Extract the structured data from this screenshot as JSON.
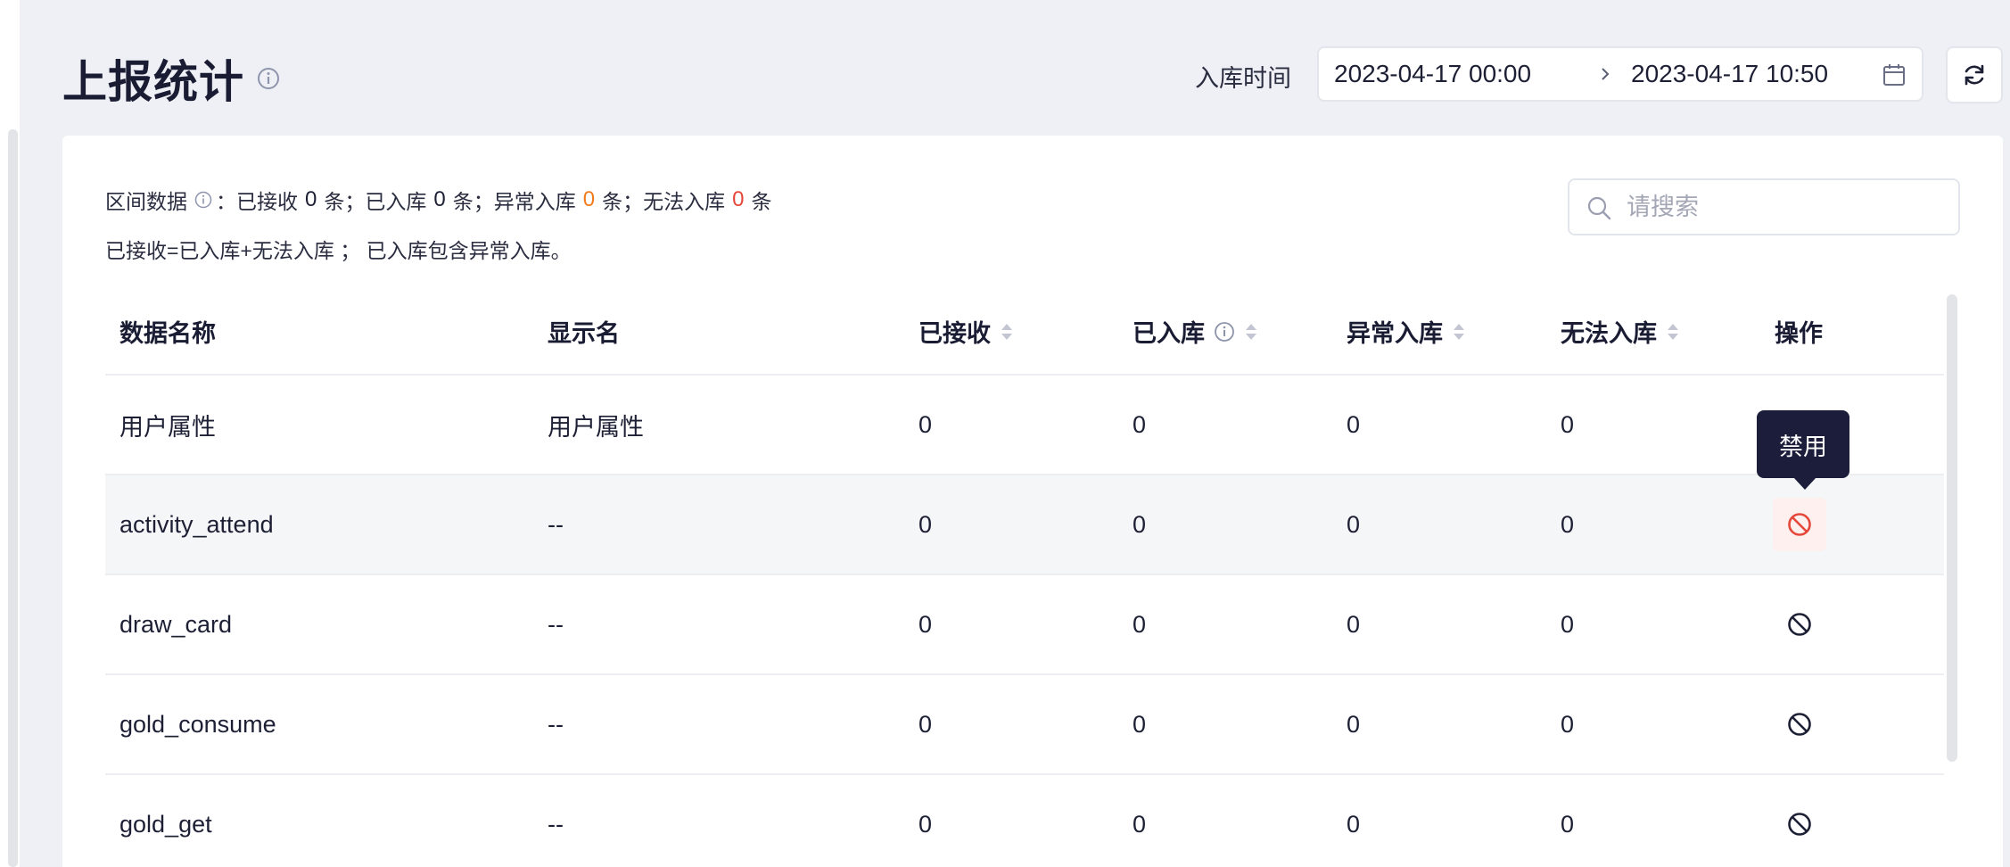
{
  "page": {
    "title": "上报统计"
  },
  "filter": {
    "time_label": "入库时间",
    "range_start": "2023-04-17 00:00",
    "range_end": "2023-04-17 10:50"
  },
  "summary": {
    "label": "区间数据",
    "colon": "：",
    "received_label": "已接收",
    "received_count": "0",
    "stored_label": "条；已入库",
    "stored_count": "0",
    "abnormal_label": "条；异常入库",
    "abnormal_count": "0",
    "failed_label": "条；无法入库",
    "failed_count": "0",
    "tail": "条",
    "formula": "已接收=已入库+无法入库 ； 已入库包含异常入库。"
  },
  "search": {
    "placeholder": "请搜索"
  },
  "table": {
    "headers": {
      "name": "数据名称",
      "display": "显示名",
      "received": "已接收",
      "stored": "已入库",
      "abnormal": "异常入库",
      "failed": "无法入库",
      "action": "操作"
    },
    "rows": [
      {
        "name": "用户属性",
        "display": "用户属性",
        "received": "0",
        "stored": "0",
        "abnormal": "0",
        "failed": "0"
      },
      {
        "name": "activity_attend",
        "display": "--",
        "received": "0",
        "stored": "0",
        "abnormal": "0",
        "failed": "0"
      },
      {
        "name": "draw_card",
        "display": "--",
        "received": "0",
        "stored": "0",
        "abnormal": "0",
        "failed": "0"
      },
      {
        "name": "gold_consume",
        "display": "--",
        "received": "0",
        "stored": "0",
        "abnormal": "0",
        "failed": "0"
      },
      {
        "name": "gold_get",
        "display": "--",
        "received": "0",
        "stored": "0",
        "abnormal": "0",
        "failed": "0"
      }
    ]
  },
  "tooltip": {
    "text": "禁用"
  },
  "icons": {
    "title_info": "info-icon",
    "range_separator": "chevron-right-icon",
    "calendar": "calendar-icon",
    "refresh": "refresh-icon",
    "search": "search-icon",
    "sort": "sort-icon",
    "disable": "ban-icon"
  },
  "colors": {
    "warning_count": "#f07c1e",
    "error_count": "#e5483a",
    "disable_active": "#e5483a",
    "tooltip_bg": "#1b1d3b"
  }
}
